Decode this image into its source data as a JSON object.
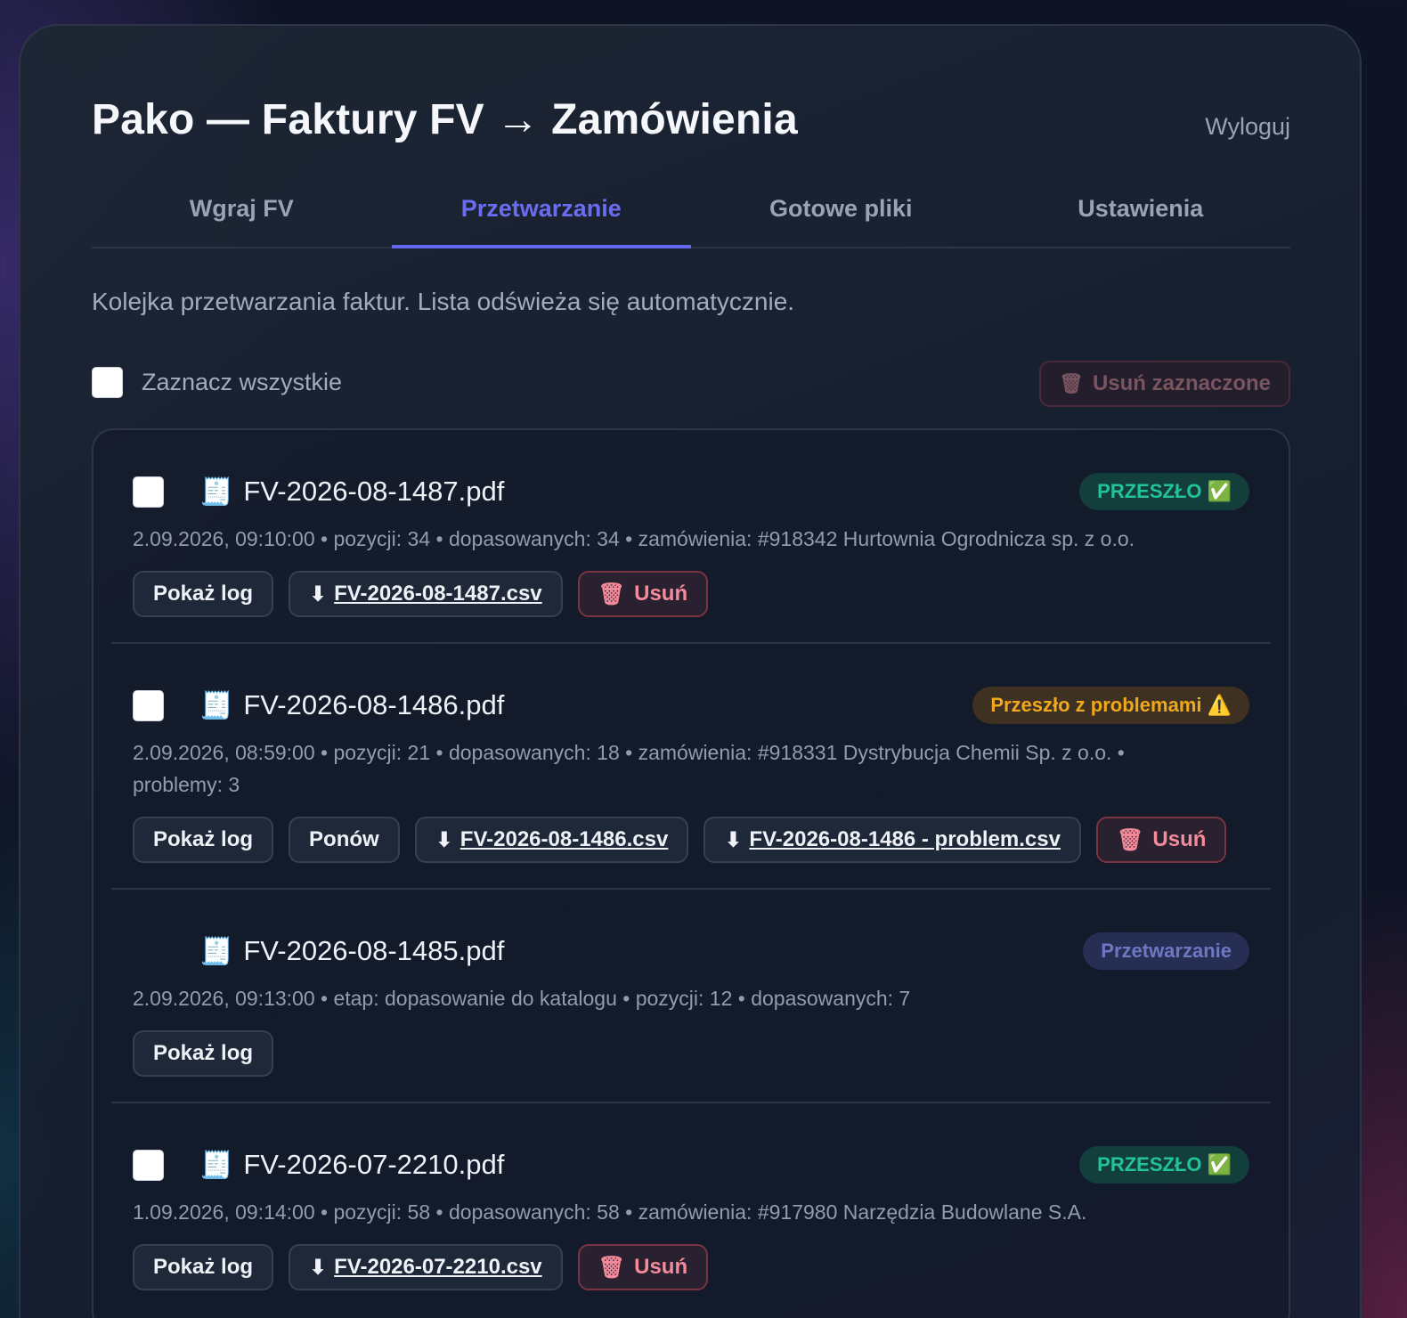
{
  "header": {
    "title": "Pako — Faktury FV → Zamówienia",
    "logout_label": "Wyloguj"
  },
  "tabs": [
    {
      "label": "Wgraj FV",
      "active": false
    },
    {
      "label": "Przetwarzanie",
      "active": true
    },
    {
      "label": "Gotowe pliki",
      "active": false
    },
    {
      "label": "Ustawienia",
      "active": false
    }
  ],
  "description": "Kolejka przetwarzania faktur. Lista odświeża się automatycznie.",
  "toolbar": {
    "select_all_label": "Zaznacz wszystkie",
    "select_all_checked": false,
    "delete_selected_icon": "🗑",
    "delete_selected_label": "Usuń zaznaczone"
  },
  "items": [
    {
      "file_icon": "🧾",
      "file_name": "FV-2026-08-1487.pdf",
      "status": "PRZESZŁO ✅",
      "meta": "2.09.2026, 09:10:00 • pozycji: 34 • dopasowanych: 34 • zamówienia: #918342 Hurtownia Ogrodnicza sp. z o.o.",
      "show_log_label": "Pokaż log",
      "csv_icon": "⬇",
      "csv_label": "FV-2026-08-1487.csv",
      "delete_icon": "🗑",
      "delete_label": "Usuń"
    },
    {
      "file_icon": "🧾",
      "file_name": "FV-2026-08-1486.pdf",
      "status": "Przeszło z problemami ⚠️",
      "meta": "2.09.2026, 08:59:00 • pozycji: 21 • dopasowanych: 18 • zamówienia: #918331 Dystrybucja Chemii Sp. z o.o. • problemy: 3",
      "show_log_label": "Pokaż log",
      "retry_label": "Ponów",
      "csv_icon": "⬇",
      "csv_label": "FV-2026-08-1486.csv",
      "problem_csv_icon": "⬇",
      "problem_csv_label": "FV-2026-08-1486 - problem.csv",
      "delete_icon": "🗑",
      "delete_label": "Usuń"
    },
    {
      "file_icon": "🧾",
      "file_name": "FV-2026-08-1485.pdf",
      "status": "Przetwarzanie",
      "meta": "2.09.2026, 09:13:00 • etap: dopasowanie do katalogu • pozycji: 12 • dopasowanych: 7",
      "show_log_label": "Pokaż log"
    },
    {
      "file_icon": "🧾",
      "file_name": "FV-2026-07-2210.pdf",
      "status": "PRZESZŁO ✅",
      "meta": "1.09.2026, 09:14:00 • pozycji: 58 • dopasowanych: 58 • zamówienia: #917980 Narzędzia Budowlane S.A.",
      "show_log_label": "Pokaż log",
      "csv_icon": "⬇",
      "csv_label": "FV-2026-07-2210.csv",
      "delete_icon": "🗑",
      "delete_label": "Usuń"
    }
  ],
  "colors": {
    "accent": "#6366f1",
    "success": "#22c39a",
    "warning": "#f0a81d",
    "danger": "#f58a9a",
    "processing": "#6e78c2"
  }
}
